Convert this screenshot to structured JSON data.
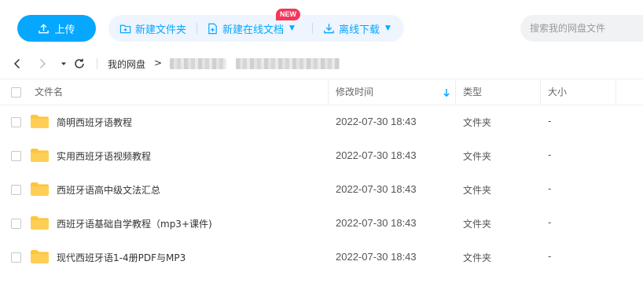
{
  "toolbar": {
    "upload_label": "上传",
    "new_folder_label": "新建文件夹",
    "new_doc_label": "新建在线文档",
    "new_badge": "NEW",
    "offline_label": "离线下载",
    "search_placeholder": "搜索我的网盘文件"
  },
  "breadcrumb": {
    "root": "我的网盘",
    "arrow": ">"
  },
  "table": {
    "headers": {
      "name": "文件名",
      "modified": "修改时间",
      "type": "类型",
      "size": "大小"
    },
    "rows": [
      {
        "name": "简明西班牙语教程",
        "modified": "2022-07-30 18:43",
        "type": "文件夹",
        "size": "-"
      },
      {
        "name": "实用西班牙语视频教程",
        "modified": "2022-07-30 18:43",
        "type": "文件夹",
        "size": "-"
      },
      {
        "name": "西班牙语高中级文法汇总",
        "modified": "2022-07-30 18:43",
        "type": "文件夹",
        "size": "-"
      },
      {
        "name": "西班牙语基础自学教程（mp3+课件)",
        "modified": "2022-07-30 18:43",
        "type": "文件夹",
        "size": "-"
      },
      {
        "name": "现代西班牙语1-4册PDF与MP3",
        "modified": "2022-07-30 18:43",
        "type": "文件夹",
        "size": "-"
      }
    ]
  },
  "colors": {
    "accent": "#06a7ff",
    "group_bg": "#eef5ff",
    "badge": "#f3375a",
    "folder": "#ffc53d"
  }
}
